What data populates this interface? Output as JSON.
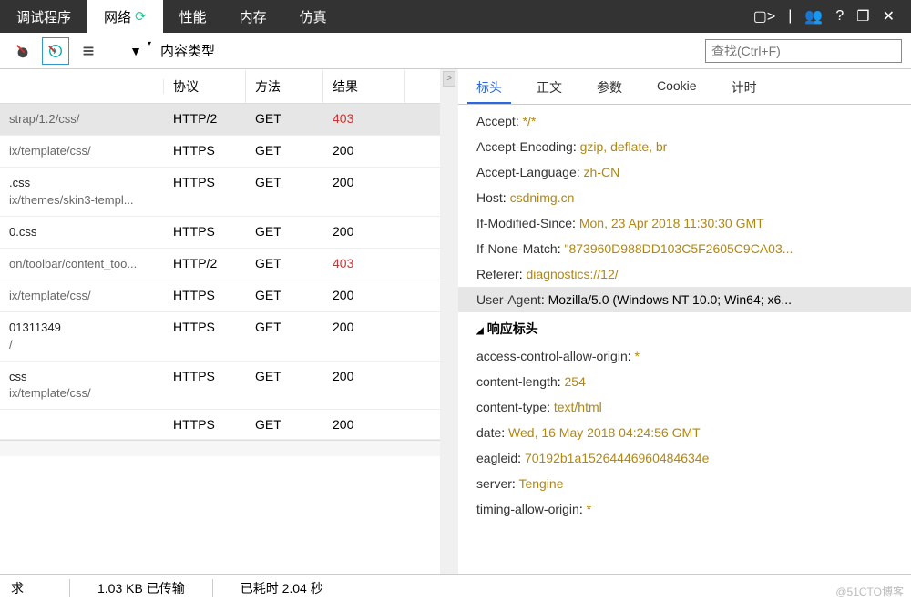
{
  "topTabs": [
    "调试程序",
    "网络",
    "性能",
    "内存",
    "仿真"
  ],
  "activeTab": 1,
  "toolbar": {
    "contentType": "内容类型"
  },
  "search": {
    "placeholder": "查找(Ctrl+F)"
  },
  "table": {
    "headers": {
      "name": "",
      "protocol": "协议",
      "method": "方法",
      "result": "结果"
    },
    "rows": [
      {
        "name1": "",
        "name2": "strap/1.2/css/",
        "protocol": "HTTP/2",
        "method": "GET",
        "result": "403",
        "sel": true
      },
      {
        "name1": "",
        "name2": "ix/template/css/",
        "protocol": "HTTPS",
        "method": "GET",
        "result": "200"
      },
      {
        "name1": ".css",
        "name2": "ix/themes/skin3-templ...",
        "protocol": "HTTPS",
        "method": "GET",
        "result": "200"
      },
      {
        "name1": "0.css",
        "name2": "",
        "protocol": "HTTPS",
        "method": "GET",
        "result": "200"
      },
      {
        "name1": "",
        "name2": "on/toolbar/content_too...",
        "protocol": "HTTP/2",
        "method": "GET",
        "result": "403"
      },
      {
        "name1": "",
        "name2": "ix/template/css/",
        "protocol": "HTTPS",
        "method": "GET",
        "result": "200"
      },
      {
        "name1": "01311349",
        "name2": "/",
        "protocol": "HTTPS",
        "method": "GET",
        "result": "200"
      },
      {
        "name1": "css",
        "name2": "ix/template/css/",
        "protocol": "HTTPS",
        "method": "GET",
        "result": "200"
      },
      {
        "name1": "",
        "name2": "",
        "protocol": "HTTPS",
        "method": "GET",
        "result": "200"
      }
    ]
  },
  "statusBar": {
    "requests": "求",
    "transferred": "1.03 KB 已传输",
    "time": "已耗时 2.04 秒"
  },
  "subTabs": [
    "标头",
    "正文",
    "参数",
    "Cookie",
    "计时"
  ],
  "activeSub": 0,
  "reqHeaders": [
    {
      "k": "Accept",
      "v": "*/*"
    },
    {
      "k": "Accept-Encoding",
      "v": "gzip, deflate, br"
    },
    {
      "k": "Accept-Language",
      "v": "zh-CN"
    },
    {
      "k": "Host",
      "v": "csdnimg.cn"
    },
    {
      "k": "If-Modified-Since",
      "v": "Mon, 23 Apr 2018 11:30:30 GMT"
    },
    {
      "k": "If-None-Match",
      "v": "\"873960D988DD103C5F2605C9CA03..."
    },
    {
      "k": "Referer",
      "v": "diagnostics://12/"
    },
    {
      "k": "User-Agent",
      "v": "Mozilla/5.0 (Windows NT 10.0; Win64; x6...",
      "sel": true
    }
  ],
  "respSection": "响应标头",
  "respHeaders": [
    {
      "k": "access-control-allow-origin",
      "v": "*"
    },
    {
      "k": "content-length",
      "v": "254"
    },
    {
      "k": "content-type",
      "v": "text/html"
    },
    {
      "k": "date",
      "v": "Wed, 16 May 2018 04:24:56 GMT"
    },
    {
      "k": "eagleid",
      "v": "70192b1a15264446960484634e"
    },
    {
      "k": "server",
      "v": "Tengine"
    },
    {
      "k": "timing-allow-origin",
      "v": "*"
    }
  ],
  "watermark": "@51CTO博客"
}
